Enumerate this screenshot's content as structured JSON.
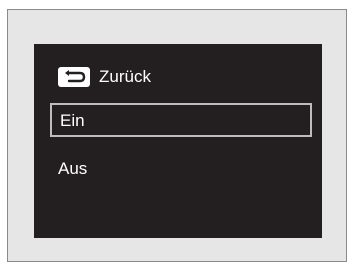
{
  "menu": {
    "back_label": "Zurück",
    "back_icon": "back-arrow-icon",
    "options": [
      {
        "label": "Ein",
        "selected": true
      },
      {
        "label": "Aus",
        "selected": false
      }
    ]
  },
  "colors": {
    "screen_bg": "#231f20",
    "text": "#ffffff",
    "selection_border": "#bdbdbd",
    "frame_bg": "#e6e6e6"
  }
}
